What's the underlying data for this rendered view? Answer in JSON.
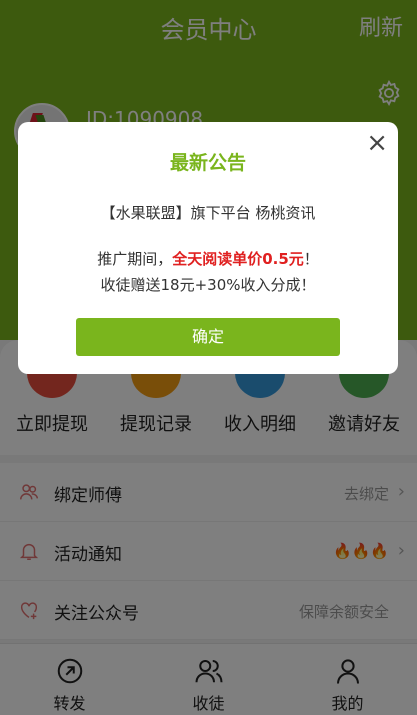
{
  "topbar": {
    "title": "会员中心",
    "refresh": "刷新"
  },
  "profile": {
    "id_text": "ID:1090908"
  },
  "actions": [
    {
      "label": "立即提现",
      "color": "#e74c3c",
      "icon": "withdraw-icon"
    },
    {
      "label": "提现记录",
      "color": "#f39c12",
      "icon": "record-icon"
    },
    {
      "label": "收入明细",
      "color": "#3498db",
      "icon": "income-icon"
    },
    {
      "label": "邀请好友",
      "color": "#4caf50",
      "icon": "invite-icon"
    }
  ],
  "list": [
    {
      "label": "绑定师傅",
      "value": "去绑定",
      "icon": "users-icon"
    },
    {
      "label": "活动通知",
      "value": "🔥🔥🔥",
      "icon": "bell-icon"
    },
    {
      "label": "关注公众号",
      "value": "保障余额安全",
      "icon": "heart-plus-icon"
    }
  ],
  "tabs": [
    {
      "label": "转发",
      "icon": "share-icon"
    },
    {
      "label": "收徒",
      "icon": "apprentice-icon"
    },
    {
      "label": "我的",
      "icon": "profile-icon"
    }
  ],
  "modal": {
    "title": "最新公告",
    "line1": "【水果联盟】旗下平台 杨桃资讯",
    "line2_pre": "推广期间，",
    "line2_highlight": "全天阅读单价0.5元",
    "line2_post": "！",
    "line3": "收徒赠送18元+30%收入分成！",
    "confirm": "确定",
    "close": "×"
  },
  "colors": {
    "brand": "#7ab51d",
    "highlight": "#e02020"
  }
}
